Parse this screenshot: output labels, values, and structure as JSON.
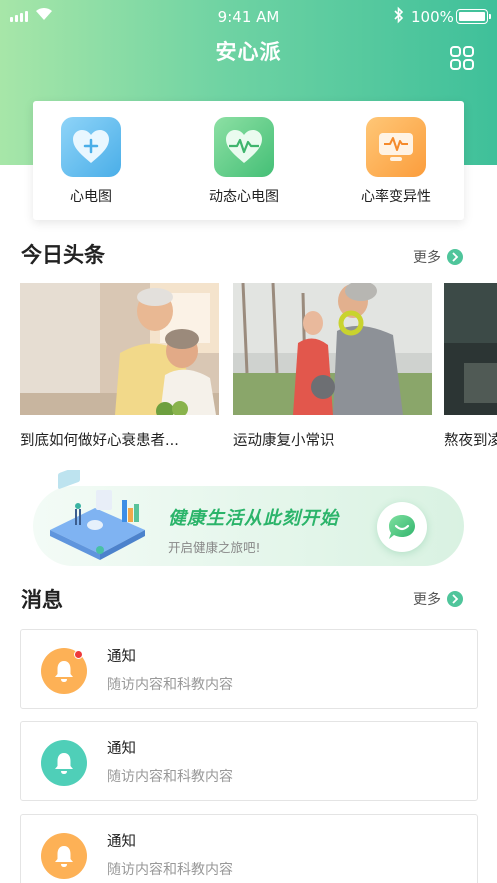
{
  "status_bar": {
    "time": "9:41 AM",
    "battery": "100%"
  },
  "header": {
    "title": "安心派"
  },
  "shortcuts": [
    {
      "label": "心电图"
    },
    {
      "label": "动态心电图"
    },
    {
      "label": "心率变异性"
    }
  ],
  "headlines": {
    "title": "今日头条",
    "more": "更多",
    "items": [
      {
        "title": "到底如何做好心衰患者..."
      },
      {
        "title": "运动康复小常识"
      },
      {
        "title": "熬夜到凌"
      }
    ]
  },
  "banner": {
    "title": "健康生活从此刻开始",
    "subtitle": "开启健康之旅吧!"
  },
  "messages": {
    "title": "消息",
    "more": "更多",
    "items": [
      {
        "title": "通知",
        "subtitle": "随访内容和科教内容",
        "color": "#fdb156",
        "unread": true
      },
      {
        "title": "通知",
        "subtitle": "随访内容和科教内容",
        "color": "#4fcfb8",
        "unread": false
      },
      {
        "title": "通知",
        "subtitle": "随访内容和科教内容",
        "color": "#fdb156",
        "unread": false
      }
    ]
  },
  "colors": {
    "accent": "#4fc59b",
    "header_start": "#a7e6a8",
    "header_end": "#3fc09a"
  }
}
